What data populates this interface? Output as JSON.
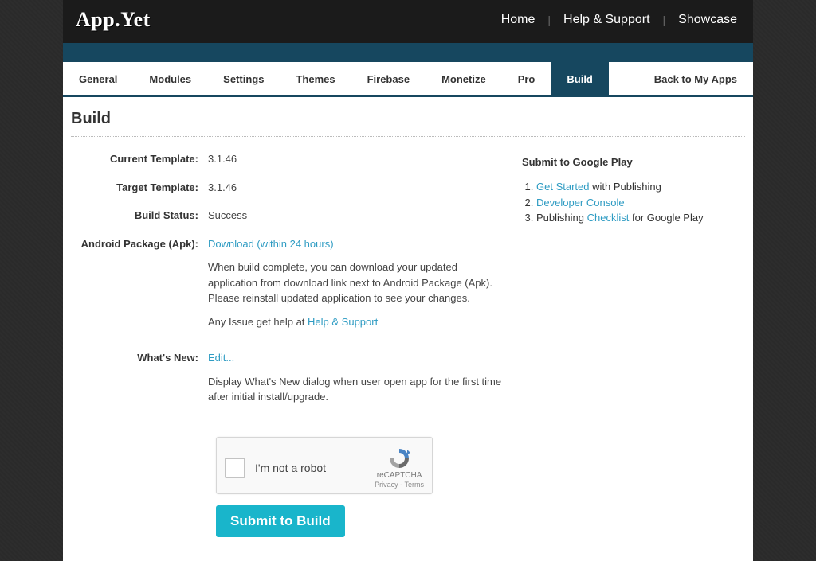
{
  "brand": "App.Yet",
  "topnav": {
    "home": "Home",
    "help": "Help & Support",
    "showcase": "Showcase"
  },
  "tabs": {
    "general": "General",
    "modules": "Modules",
    "settings": "Settings",
    "themes": "Themes",
    "firebase": "Firebase",
    "monetize": "Monetize",
    "pro": "Pro",
    "build": "Build",
    "back": "Back to My Apps"
  },
  "page_title": "Build",
  "form": {
    "labels": {
      "current_template": "Current Template:",
      "target_template": "Target Template:",
      "build_status": "Build Status:",
      "android_pkg": "Android Package (Apk):",
      "whats_new": "What's New:"
    },
    "values": {
      "current_template": "3.1.46",
      "target_template": "3.1.46",
      "build_status": "Success",
      "apk_download": "Download (within 24 hours)",
      "apk_desc": "When build complete, you can download your updated application from download link next to Android Package (Apk). Please reinstall updated application to see your changes.",
      "issue_prefix": "Any Issue get help at ",
      "issue_link": "Help & Support",
      "edit": "Edit...",
      "whats_new_desc": "Display What's New dialog when user open app for the first time after initial install/upgrade."
    }
  },
  "side": {
    "heading": "Submit to Google Play",
    "item1_link": "Get Started",
    "item1_rest": " with Publishing",
    "item2_link": "Developer Console",
    "item3_pre": "Publishing ",
    "item3_link": "Checklist",
    "item3_rest": " for Google Play"
  },
  "recaptcha": {
    "text": "I'm not a robot",
    "name": "reCAPTCHA",
    "pt": "Privacy - Terms"
  },
  "submit": "Submit to Build"
}
